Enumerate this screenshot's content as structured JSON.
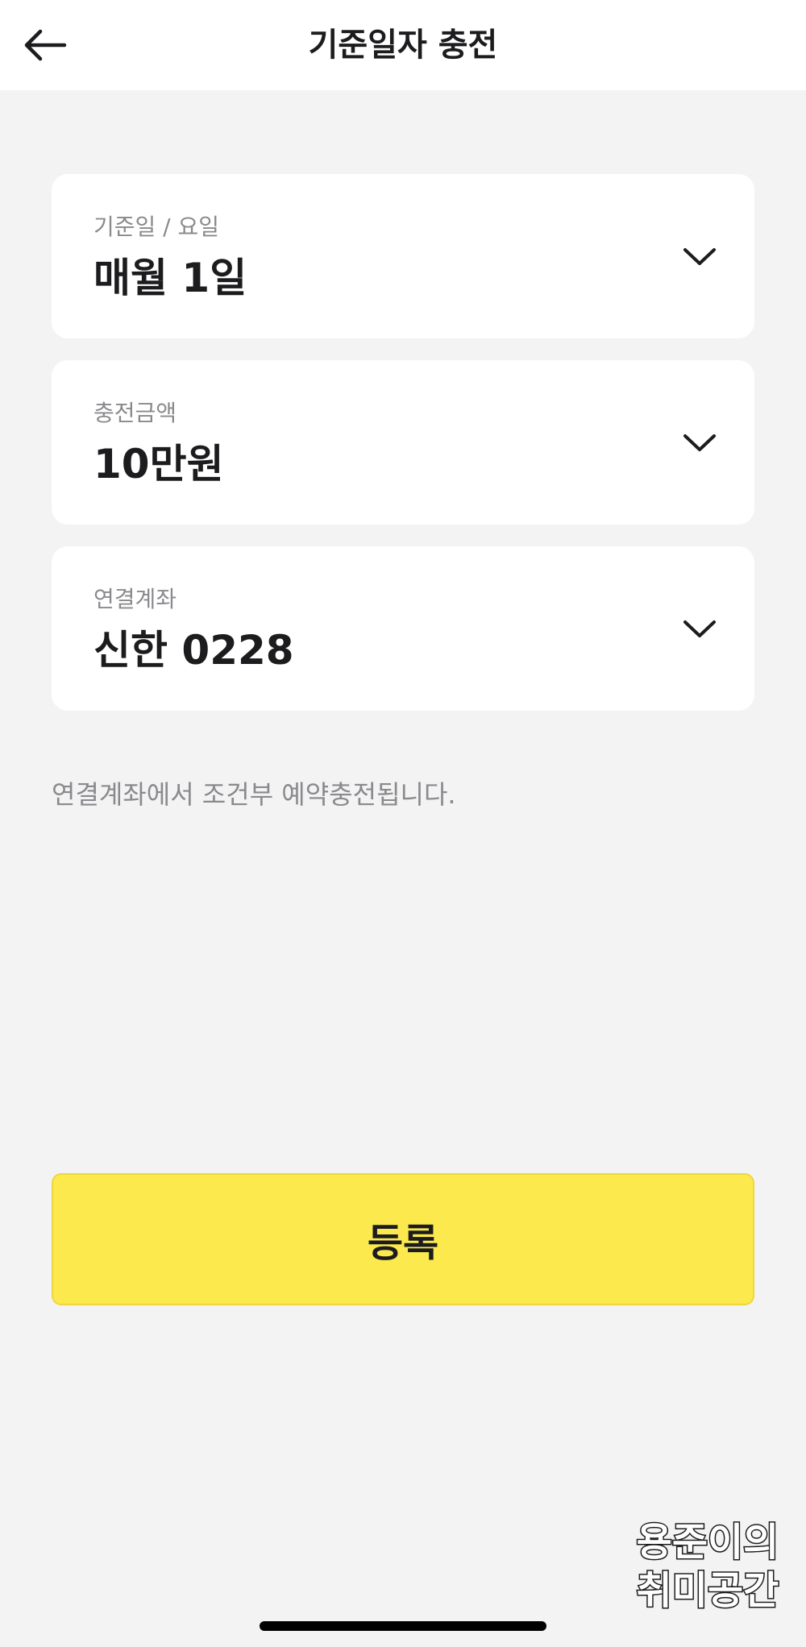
{
  "header": {
    "title": "기준일자 충전",
    "back_icon": "arrow-left-icon"
  },
  "fields": {
    "date": {
      "label": "기준일 / 요일",
      "value": "매월 1일"
    },
    "amount": {
      "label": "충전금액",
      "value": "10만원"
    },
    "account": {
      "label": "연결계좌",
      "value": "신한 0228"
    }
  },
  "notice": "연결계좌에서 조건부 예약충전됩니다.",
  "submit_label": "등록",
  "watermark": {
    "line1": "용준이의",
    "line2": "취미공간"
  },
  "colors": {
    "background": "#f3f3f3",
    "accent": "#fbe94e",
    "text": "#1c1c1e",
    "muted": "#8a8a8e"
  }
}
